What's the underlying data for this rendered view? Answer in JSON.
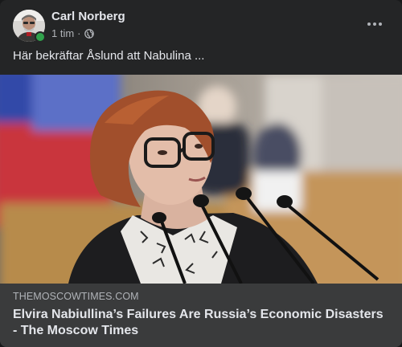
{
  "post": {
    "author": "Carl Norberg",
    "timestamp": "1 tim",
    "separator": "·",
    "privacy_icon": "globe-icon",
    "options_icon": "more-horizontal-icon",
    "text": "Här bekräftar Åslund att Nabulina ...",
    "online_status_color": "#31a24c"
  },
  "link_preview": {
    "domain": "THEMOSCOWTIMES.COM",
    "title": "Elvira Nabiullina’s Failures Are Russia’s Economic Disasters - The Moscow Times"
  },
  "colors": {
    "card_background": "#242526",
    "preview_background": "#3a3b3c",
    "primary_text": "#e4e6eb",
    "secondary_text": "#b0b3b8"
  }
}
